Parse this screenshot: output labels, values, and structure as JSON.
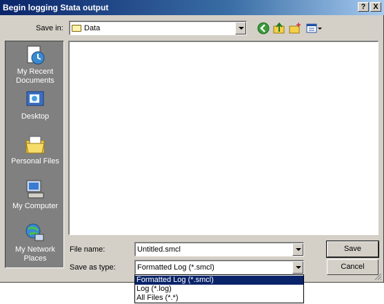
{
  "window": {
    "title": "Begin logging Stata output"
  },
  "titlebar_buttons": {
    "help": "?",
    "close": "X"
  },
  "savein": {
    "label": "Save in:",
    "value": "Data"
  },
  "toolbar": {
    "icons": [
      "back-icon",
      "up-folder-icon",
      "new-folder-icon",
      "view-menu-icon"
    ]
  },
  "places": [
    {
      "label": "My Recent Documents",
      "icon": "recent-documents-icon"
    },
    {
      "label": "Desktop",
      "icon": "desktop-icon"
    },
    {
      "label": "Personal Files",
      "icon": "personal-files-icon"
    },
    {
      "label": "My Computer",
      "icon": "my-computer-icon"
    },
    {
      "label": "My Network Places",
      "icon": "network-places-icon"
    }
  ],
  "filename": {
    "label": "File name:",
    "value": "Untitled.smcl"
  },
  "savetype": {
    "label": "Save as type:",
    "value": "Formatted Log (*.smcl)",
    "options": [
      "Formatted Log (*.smcl)",
      "Log (*.log)",
      "All Files (*.*)"
    ]
  },
  "buttons": {
    "save": "Save",
    "cancel": "Cancel"
  },
  "colors": {
    "titlebar": "#0a246a",
    "face": "#d4d0c8",
    "selection": "#0a246a"
  }
}
